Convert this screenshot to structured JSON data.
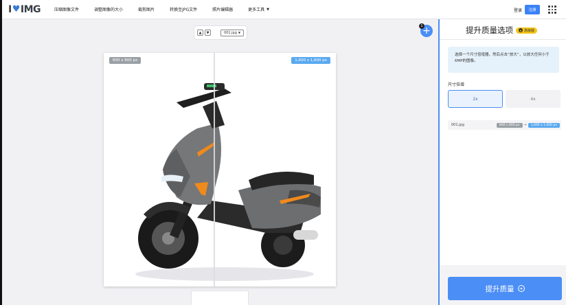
{
  "app": {
    "logo_left": "I",
    "logo_right": "IMG"
  },
  "nav": {
    "items": [
      "压缩图像文件",
      "调整图像的大小",
      "裁剪图片",
      "转换至JPG文件",
      "照片编辑器",
      "更多工具"
    ],
    "login": "登录",
    "signup": "注册"
  },
  "toolbar": {
    "file_name": "001.jpg",
    "file_count": "1"
  },
  "preview": {
    "original_size": "800 x 800 px",
    "upscaled_size": "1,600 x 1,600 px"
  },
  "panel": {
    "title": "提升质量选项",
    "premium_label": "高级版",
    "info_text": "选择一个尺寸倍增器，然后点击“放大”，以放大任何小于6MP的图像。",
    "section_label": "尺寸倍增",
    "options": [
      "2x",
      "4x"
    ],
    "selected_option": "2x",
    "file_row": {
      "name": "001.jpg",
      "from": "800 x 800 px",
      "to": "1,600 x 1,600 px"
    },
    "action_label": "提升质量"
  },
  "colors": {
    "accent": "#4b8ef5",
    "premium": "#f5c518",
    "tag_original": "#9aa0a6",
    "tag_upscaled": "#5aa9f0"
  },
  "icons": [
    "heart-icon",
    "caret-down-icon",
    "apps-grid-icon",
    "arrow-up-icon",
    "arrow-down-icon",
    "plus-icon",
    "crown-icon",
    "arrow-right-circle-icon"
  ]
}
